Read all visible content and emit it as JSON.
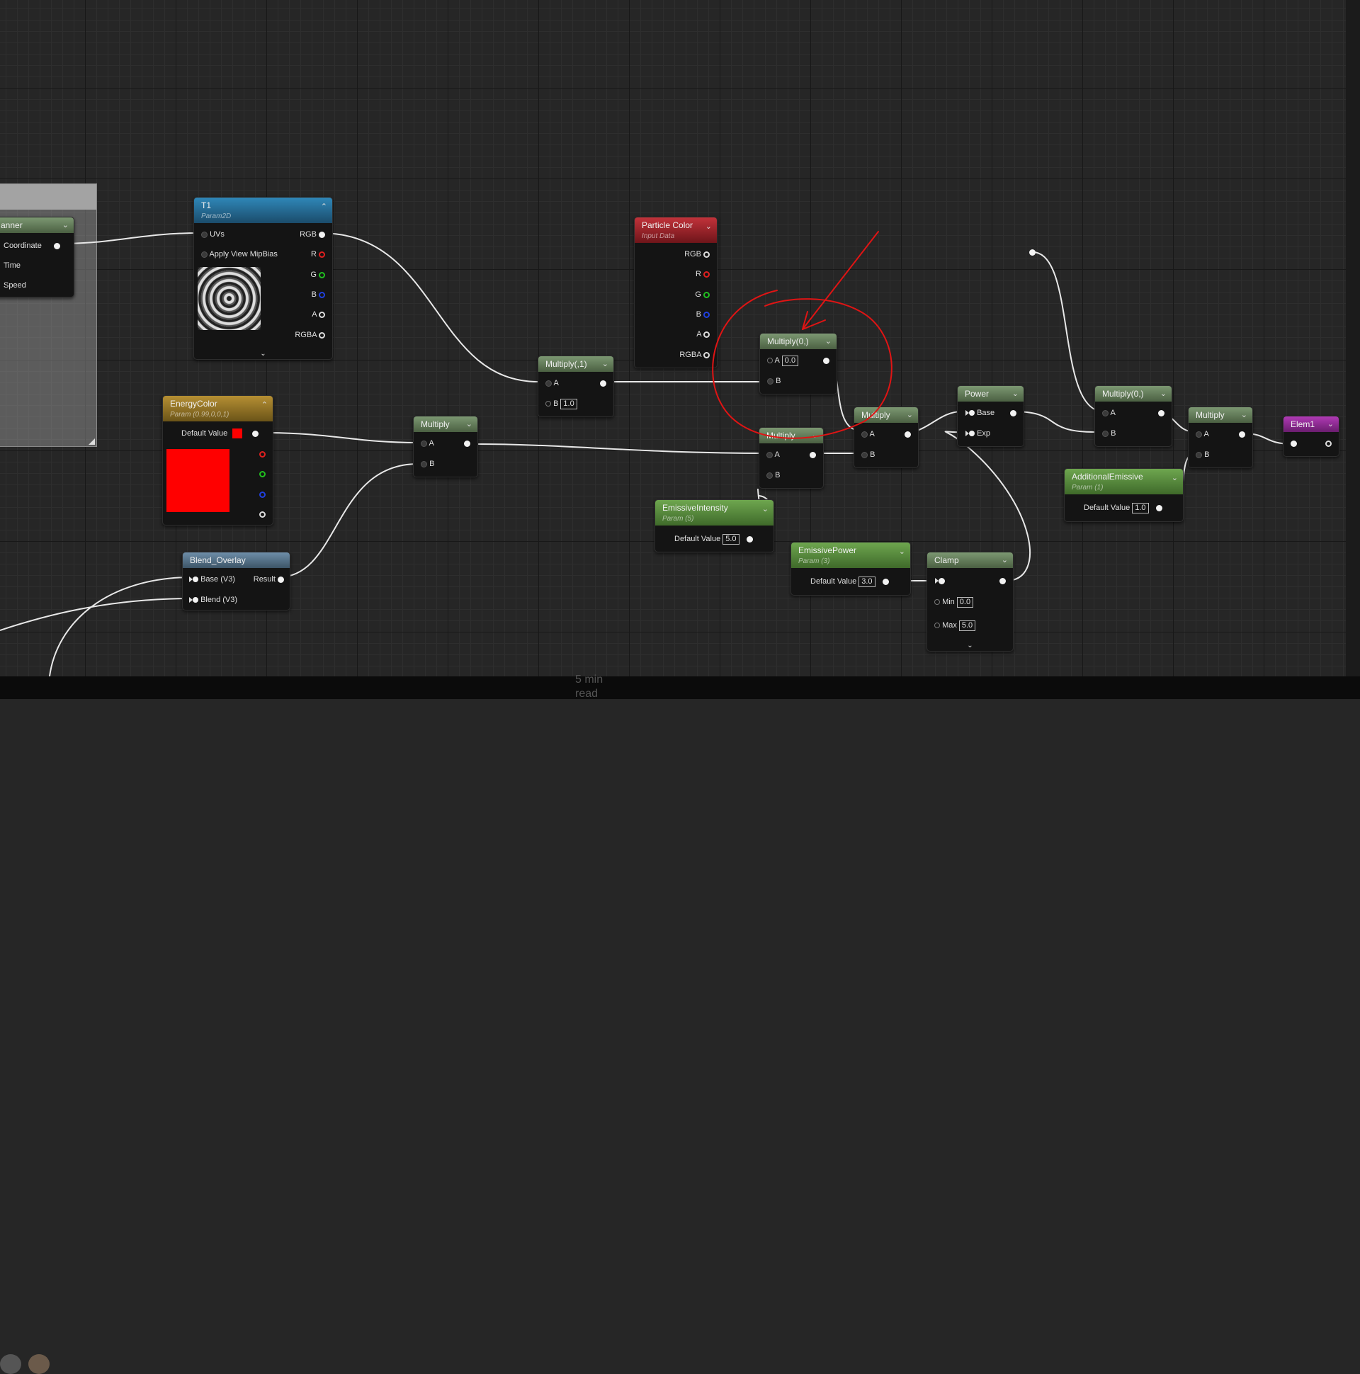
{
  "nodes": {
    "panner": {
      "title": "anner",
      "pins": [
        "Coordinate",
        "Time",
        "Speed"
      ]
    },
    "t1": {
      "title": "T1",
      "subtitle": "Param2D",
      "in_pins": [
        "UVs",
        "Apply View MipBias"
      ],
      "out_pins": [
        "RGB",
        "R",
        "G",
        "B",
        "A",
        "RGBA"
      ]
    },
    "particle_color": {
      "title": "Particle Color",
      "subtitle": "Input Data",
      "out_pins": [
        "RGB",
        "R",
        "G",
        "B",
        "A",
        "RGBA"
      ]
    },
    "multiply_1": {
      "title": "Multiply(,1)",
      "pin_a": "A",
      "pin_b": "B",
      "b_value": "1.0"
    },
    "multiply_0_top": {
      "title": "Multiply(0,)",
      "pin_a": "A",
      "a_value": "0.0",
      "pin_b": "B"
    },
    "energy_color": {
      "title": "EnergyColor",
      "subtitle": "Param (0.99,0,0,1)",
      "default_label": "Default Value",
      "color": "#ff0000"
    },
    "multiply_mid": {
      "title": "Multiply",
      "pin_a": "A",
      "pin_b": "B"
    },
    "multiply_center": {
      "title": "Multiply",
      "pin_a": "A",
      "pin_b": "B"
    },
    "multiply_right1": {
      "title": "Multiply",
      "pin_a": "A",
      "pin_b": "B"
    },
    "power": {
      "title": "Power",
      "pin_base": "Base",
      "pin_exp": "Exp"
    },
    "multiply_0_right": {
      "title": "Multiply(0,)",
      "pin_a": "A",
      "pin_b": "B"
    },
    "multiply_final": {
      "title": "Multiply",
      "pin_a": "A",
      "pin_b": "B"
    },
    "elem1": {
      "title": "Elem1"
    },
    "emissive_intensity": {
      "title": "EmissiveIntensity",
      "subtitle": "Param (5)",
      "default_label": "Default Value",
      "value": "5.0"
    },
    "emissive_power": {
      "title": "EmissivePower",
      "subtitle": "Param (3)",
      "default_label": "Default Value",
      "value": "3.0"
    },
    "clamp": {
      "title": "Clamp",
      "min_label": "Min",
      "min_value": "0.0",
      "max_label": "Max",
      "max_value": "5.0"
    },
    "additional_emissive": {
      "title": "AdditionalEmissive",
      "subtitle": "Param (1)",
      "default_label": "Default Value",
      "value": "1.0"
    },
    "blend_overlay": {
      "title": "Blend_Overlay",
      "pin_base": "Base (V3)",
      "pin_result": "Result",
      "pin_blend": "Blend (V3)"
    }
  },
  "footer": {
    "read_time_1": "5 min",
    "read_time_2": "read"
  },
  "colors": {
    "annotation": "#e01414",
    "background": "#262626",
    "grid": "#181818"
  }
}
